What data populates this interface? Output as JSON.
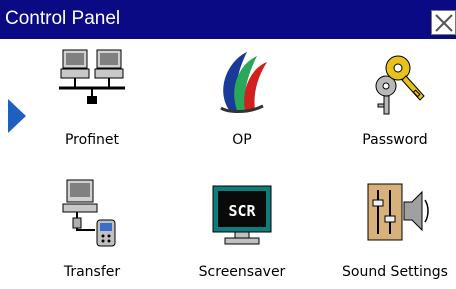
{
  "window": {
    "title": "Control Panel",
    "close_icon": "close-icon"
  },
  "selection_indicator": "arrow-right-icon",
  "items": [
    {
      "label": "Profinet",
      "icon": "network-computers-icon"
    },
    {
      "label": "OP",
      "icon": "op-logo-icon"
    },
    {
      "label": "Password",
      "icon": "keys-icon"
    },
    {
      "label": "Transfer",
      "icon": "computer-transfer-icon"
    },
    {
      "label": "Screensaver",
      "icon": "monitor-scr-icon"
    },
    {
      "label": "Sound Settings",
      "icon": "speaker-mixer-icon"
    }
  ],
  "colors": {
    "titlebar": "#0a0a84",
    "selection_arrow": "#1f5fbf"
  }
}
